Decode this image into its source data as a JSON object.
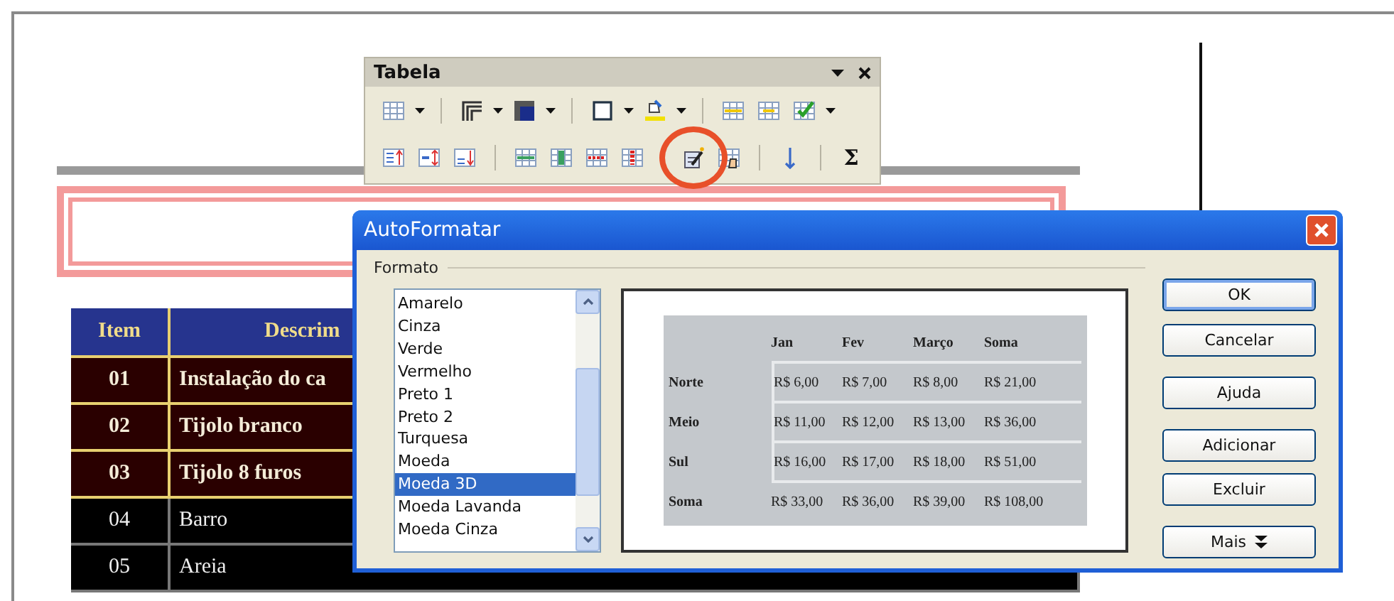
{
  "document": {
    "table": {
      "columns": [
        "Item",
        "Descrim"
      ],
      "rows": [
        {
          "item": "01",
          "description": "Instalação do ca",
          "kind": "highlight"
        },
        {
          "item": "02",
          "description": "Tijolo branco",
          "kind": "highlight"
        },
        {
          "item": "03",
          "description": "Tijolo 8 furos",
          "kind": "highlight"
        },
        {
          "item": "04",
          "description": "Barro",
          "kind": "plain"
        },
        {
          "item": "05",
          "description": "Areia",
          "kind": "plain"
        }
      ]
    }
  },
  "toolbar": {
    "title": "Tabela",
    "sum_label": "Σ",
    "autoformat_highlighted": true
  },
  "dialog": {
    "title": "AutoFormatar",
    "group_label": "Formato",
    "formats": [
      {
        "label": "Amarelo",
        "selected": false
      },
      {
        "label": "Cinza",
        "selected": false
      },
      {
        "label": "Verde",
        "selected": false
      },
      {
        "label": "Vermelho",
        "selected": false
      },
      {
        "label": "Preto 1",
        "selected": false
      },
      {
        "label": "Preto 2",
        "selected": false
      },
      {
        "label": "Turquesa",
        "selected": false
      },
      {
        "label": "Moeda",
        "selected": false
      },
      {
        "label": "Moeda 3D",
        "selected": true
      },
      {
        "label": "Moeda Lavanda",
        "selected": false
      },
      {
        "label": "Moeda Cinza",
        "selected": false
      }
    ],
    "preview": {
      "columns": [
        "Jan",
        "Fev",
        "Março",
        "Soma"
      ],
      "rows": [
        {
          "label": "Norte",
          "cells": [
            "R$ 6,00",
            "R$ 7,00",
            "R$ 8,00",
            "R$ 21,00"
          ]
        },
        {
          "label": "Meio",
          "cells": [
            "R$ 11,00",
            "R$ 12,00",
            "R$ 13,00",
            "R$ 36,00"
          ]
        },
        {
          "label": "Sul",
          "cells": [
            "R$ 16,00",
            "R$ 17,00",
            "R$ 18,00",
            "R$ 51,00"
          ]
        },
        {
          "label": "Soma",
          "cells": [
            "R$ 33,00",
            "R$ 36,00",
            "R$ 39,00",
            "R$ 108,00"
          ]
        }
      ]
    },
    "buttons": [
      {
        "label": "OK",
        "default": true,
        "kind": "plain"
      },
      {
        "label": "Cancelar",
        "default": false,
        "kind": "plain"
      },
      {
        "label": "Ajuda",
        "default": false,
        "kind": "plain"
      },
      {
        "label": "Adicionar",
        "default": false,
        "kind": "plain"
      },
      {
        "label": "Excluir",
        "default": false,
        "kind": "plain"
      },
      {
        "label": "Mais",
        "default": false,
        "kind": "more"
      }
    ]
  }
}
